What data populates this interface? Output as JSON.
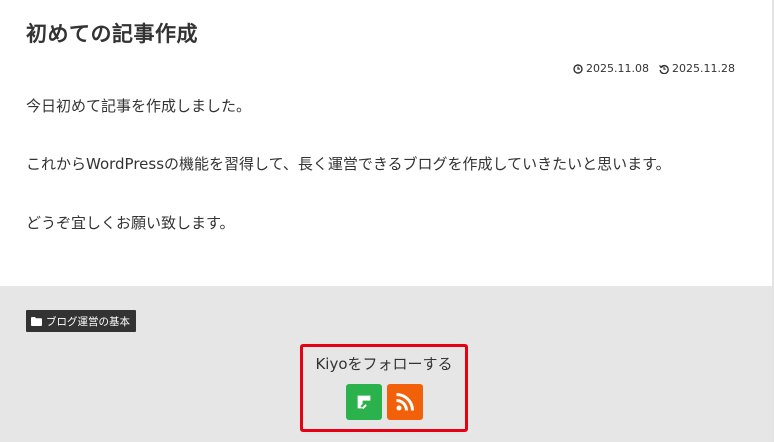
{
  "post": {
    "title": "初めての記事作成",
    "published": "2025.11.08",
    "updated": "2025.11.28",
    "paragraphs": [
      "今日初めて記事を作成しました。",
      "これからWordPressの機能を習得して、長く運営できるブログを作成していきたいと思います。",
      "どうぞ宜しくお願い致します。"
    ]
  },
  "category": {
    "label": "ブログ運営の基本",
    "icon": "folder-icon"
  },
  "follow": {
    "title": "Kiyoをフォローする",
    "buttons": [
      {
        "name": "feedly",
        "icon": "feedly-icon",
        "color": "#2bb24c"
      },
      {
        "name": "rss",
        "icon": "rss-icon",
        "color": "#f26109"
      }
    ],
    "highlight_color": "#e60012"
  },
  "colors": {
    "text": "#333333",
    "footer_bg": "#e6e6e6",
    "tag_bg": "#333333"
  }
}
